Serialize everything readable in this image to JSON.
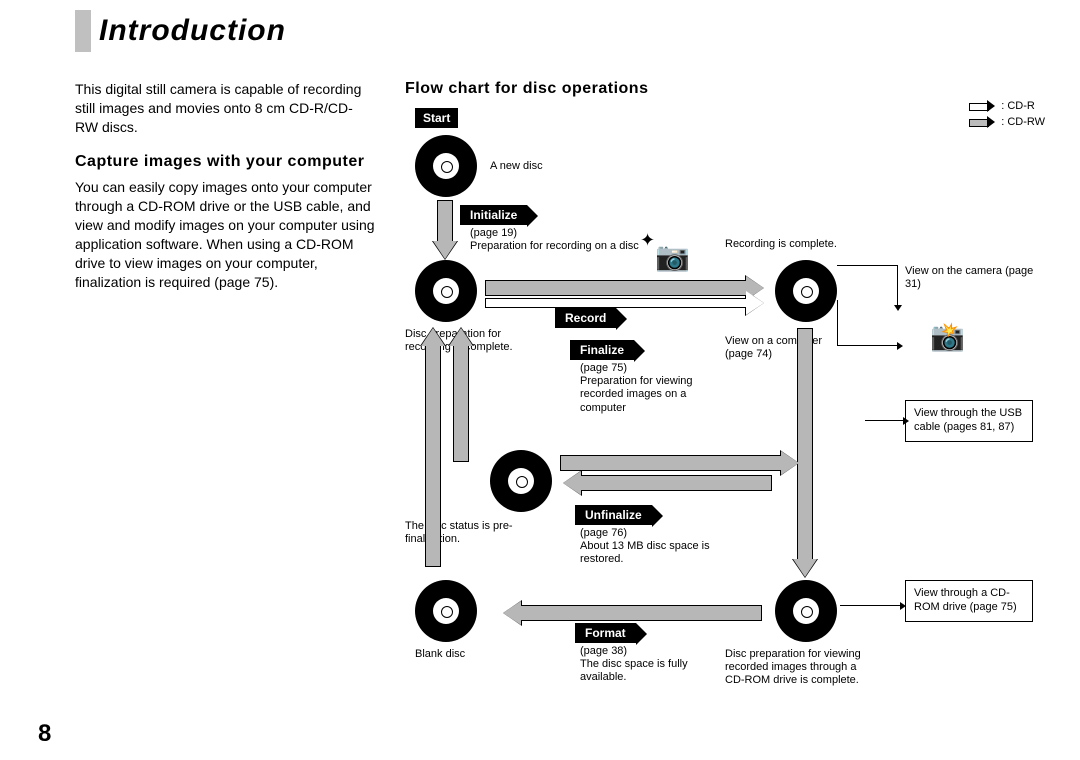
{
  "title": "Introduction",
  "page_number": "8",
  "left": {
    "para1": "This digital still camera is capable of recording still images and movies onto 8 cm CD-R/CD-RW discs.",
    "subhead": "Capture images with your computer",
    "para2": "You can easily copy images onto your computer through a CD-ROM drive or the USB cable, and view and modify images on your computer using application software. When using a CD-ROM drive to view images on your computer, finalization is required (page 75)."
  },
  "flow": {
    "title": "Flow chart for disc operations",
    "legend": {
      "cdr": ": CD-R",
      "cdrw": ": CD-RW"
    },
    "start": "Start",
    "a_new_disc": "A new disc",
    "initialize": "Initialize",
    "initialize_note": "(page 19)\nPreparation for recording on a disc",
    "disc_prep_complete": "Disc preparation for recording is complete.",
    "record": "Record",
    "recording_complete": "Recording is complete.",
    "view_camera": "View on the camera (page 31)",
    "view_computer": "View on a computer (page 74)",
    "finalize": "Finalize",
    "finalize_note": "(page 75)\nPreparation for viewing recorded images on a computer",
    "unfinalize": "Unfinalize",
    "unfinalize_note": "(page 76)\nAbout 13 MB disc space is restored.",
    "prefinal": "The disc status is pre-finalization.",
    "format": "Format",
    "format_note": "(page 38)\nThe disc space is fully available.",
    "blank_disc": "Blank disc",
    "disc_view_complete": "Disc preparation for viewing recorded images through a CD-ROM drive is complete.",
    "usb_box": "View through the USB cable (pages 81, 87)",
    "cdrom_box": "View through a CD-ROM drive (page 75)"
  }
}
